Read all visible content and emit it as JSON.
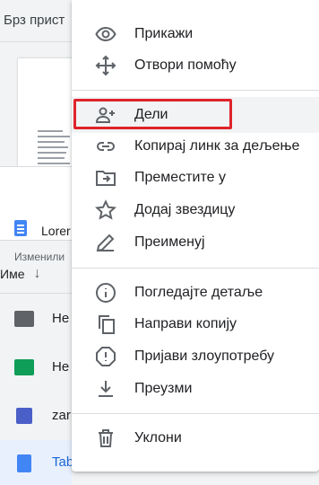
{
  "background": {
    "quick_access_label": "Брз прист",
    "card": {
      "title": "Lorer",
      "subtitle": "Изменили",
      "thumb_text": "Lorem ipsum"
    },
    "list_header": {
      "sort_label": "Име",
      "sort_arrow": "↓"
    },
    "rows": [
      {
        "label": "Не",
        "icon": "folder-icon"
      },
      {
        "label": "Не",
        "icon": "shared-folder-icon"
      },
      {
        "label": "zar",
        "icon": "form-icon"
      },
      {
        "label": "Tab",
        "icon": "document-icon"
      }
    ]
  },
  "menu": {
    "items": [
      {
        "label": "Прикажи",
        "icon": "eye-icon"
      },
      {
        "label": "Отвори помоћу",
        "icon": "move-arrows-icon"
      },
      {
        "label": "Дели",
        "icon": "person-add-icon"
      },
      {
        "label": "Копирај линк за дељење",
        "icon": "link-icon"
      },
      {
        "label": "Преместите у",
        "icon": "move-to-folder-icon"
      },
      {
        "label": "Додај звездицу",
        "icon": "star-icon"
      },
      {
        "label": "Преименуј",
        "icon": "pencil-icon"
      },
      {
        "label": "Погледајте детаље",
        "icon": "info-icon"
      },
      {
        "label": "Направи копију",
        "icon": "copy-icon"
      },
      {
        "label": "Пријави злоупотребу",
        "icon": "report-icon"
      },
      {
        "label": "Преузми",
        "icon": "download-icon"
      },
      {
        "label": "Уклони",
        "icon": "trash-icon"
      }
    ],
    "highlighted": "Дели"
  },
  "colors": {
    "highlight_outline": "#e0232b",
    "icon_gray": "#5f6368",
    "folder_green": "#0f9d58",
    "doc_blue": "#4285f4",
    "form_indigo": "#4b5fc9"
  }
}
